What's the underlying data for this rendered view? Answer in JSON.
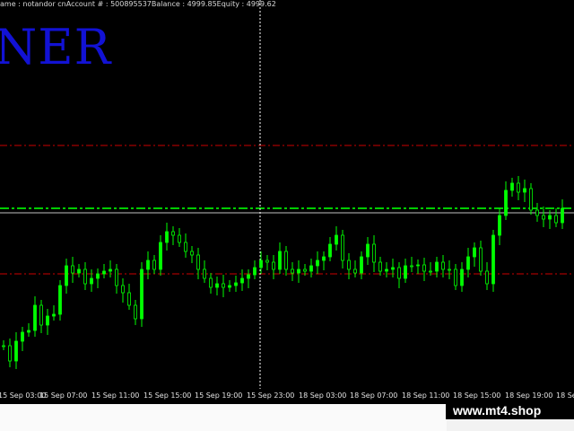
{
  "header": {
    "text": "ame  :  notandor cnAccount #  :  500895537Balance  :  4999.85Equity  :  4999.62"
  },
  "overlay_text": "NER",
  "watermark": "www.mt4.shop",
  "colors": {
    "background": "#000000",
    "candles": "#00ff00",
    "red_level": "#cc0000",
    "green_level": "#00cc00",
    "price_line": "#c0c0c0",
    "cursor": "#ffffff",
    "overlay_text": "#1212d4"
  },
  "chart_data": {
    "type": "line",
    "x": [
      "15 Sep 03:00",
      "15 Sep 07:00",
      "15 Sep 11:00",
      "15 Sep 15:00",
      "15 Sep 19:00",
      "15 Sep 23:00",
      "18 Sep 03:00",
      "18 Sep 07:00",
      "18 Sep 11:00",
      "18 Sep 15:00",
      "18 Sep 19:00",
      "18 Se"
    ],
    "series": [
      {
        "values": [
          385,
          402,
          380,
          370,
          368,
          340,
          362,
          352,
          350,
          318,
          296,
          304,
          300,
          316,
          310,
          305,
          302,
          300,
          318,
          326,
          340,
          355,
          300,
          290,
          300,
          270,
          258,
          262,
          270,
          280,
          284,
          300,
          310,
          320,
          316,
          320,
          318,
          315,
          310,
          306,
          298,
          290,
          292,
          300,
          280,
          300,
          304,
          300,
          302,
          296,
          290,
          286,
          272,
          262,
          290,
          300,
          304,
          286,
          272,
          292,
          302,
          300,
          298,
          310,
          296,
          296,
          295,
          302,
          302,
          292,
          300,
          300,
          318,
          300,
          286,
          276,
          302,
          316,
          262,
          240,
          212,
          204,
          214,
          210,
          234,
          240,
          244,
          240,
          248,
          232
        ]
      }
    ],
    "levels": [
      162,
      232,
      236,
      305
    ],
    "cursor_x": 290
  }
}
